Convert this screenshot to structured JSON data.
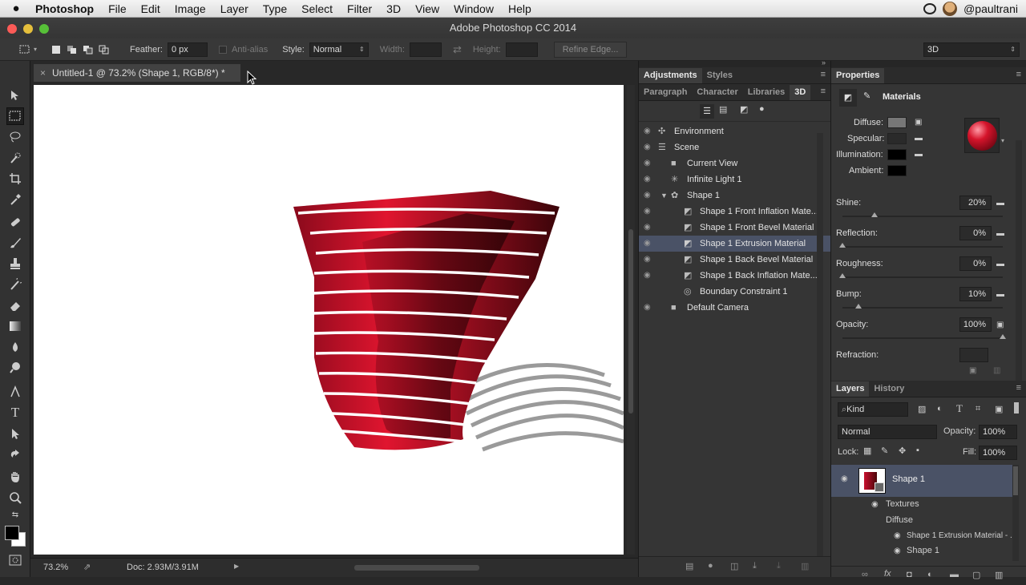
{
  "menubar": {
    "apple": "",
    "app_name": "Photoshop",
    "items": [
      "File",
      "Edit",
      "Image",
      "Layer",
      "Type",
      "Select",
      "Filter",
      "3D",
      "View",
      "Window",
      "Help"
    ],
    "user": "@paultrani"
  },
  "titlebar": {
    "title": "Adobe Photoshop CC 2014"
  },
  "options": {
    "feather_label": "Feather:",
    "feather_value": "0 px",
    "antialias_label": "Anti-alias",
    "style_label": "Style:",
    "style_value": "Normal",
    "width_label": "Width:",
    "height_label": "Height:",
    "refine_label": "Refine Edge...",
    "workspace_value": "3D"
  },
  "document": {
    "tab_title": "Untitled-1 @ 73.2% (Shape 1, RGB/8*) *",
    "zoom": "73.2%",
    "doc_size": "Doc: 2.93M/3.91M"
  },
  "mid_panel": {
    "tabs_top": [
      "Adjustments",
      "Styles"
    ],
    "tabs_bottom": [
      "Paragraph",
      "Character",
      "Libraries",
      "3D"
    ],
    "scene_items": [
      {
        "label": "Environment"
      },
      {
        "label": "Scene"
      },
      {
        "label": "Current View"
      },
      {
        "label": "Infinite Light 1"
      },
      {
        "label": "Shape 1"
      },
      {
        "label": "Shape 1 Front Inflation Mate..."
      },
      {
        "label": "Shape 1 Front Bevel Material"
      },
      {
        "label": "Shape 1 Extrusion Material"
      },
      {
        "label": "Shape 1 Back Bevel Material"
      },
      {
        "label": "Shape 1 Back Inflation Mate..."
      },
      {
        "label": "Boundary Constraint 1"
      },
      {
        "label": "Default Camera"
      }
    ]
  },
  "properties": {
    "tab": "Properties",
    "section": "Materials",
    "diffuse_label": "Diffuse:",
    "specular_label": "Specular:",
    "illumination_label": "Illumination:",
    "ambient_label": "Ambient:",
    "shine_label": "Shine:",
    "shine_value": "20%",
    "shine_level": 20,
    "reflection_label": "Reflection:",
    "reflection_value": "0%",
    "reflection_level": 0,
    "roughness_label": "Roughness:",
    "roughness_value": "0%",
    "roughness_level": 0,
    "bump_label": "Bump:",
    "bump_value": "10%",
    "bump_level": 10,
    "opacity_label": "Opacity:",
    "opacity_value": "100%",
    "opacity_level": 100,
    "refraction_label": "Refraction:"
  },
  "layers": {
    "tabs": [
      "Layers",
      "History"
    ],
    "kind_label": "Kind",
    "blend_mode": "Normal",
    "opacity_label": "Opacity:",
    "opacity_value": "100%",
    "lock_label": "Lock:",
    "fill_label": "Fill:",
    "fill_value": "100%",
    "layer_name": "Shape 1",
    "textures_label": "Textures",
    "diffuse_label": "Diffuse",
    "sub_items": [
      "Shape 1 Extrusion Material - ...",
      "Shape 1"
    ]
  },
  "colors": {
    "accent_selection": "#4a5266",
    "shape_red": "#c8102e"
  }
}
